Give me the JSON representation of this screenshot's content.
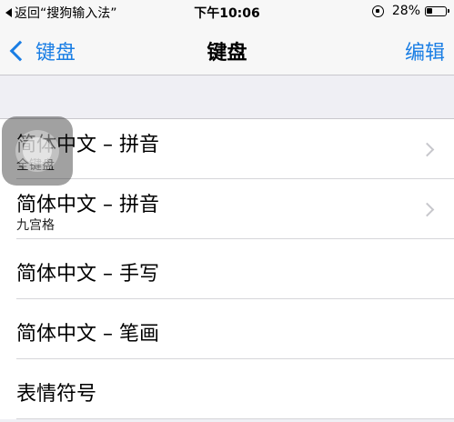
{
  "status_bar": {
    "back_label": "返回“搜狗输入法”",
    "time": "下午10:06",
    "battery": "28%"
  },
  "nav": {
    "back_label": "键盘",
    "title": "键盘",
    "edit_label": "编辑"
  },
  "keyboards": [
    {
      "title": "简体中文 – 拼音",
      "subtitle": "全键盘"
    },
    {
      "title": "简体中文 – 拼音",
      "subtitle": "九宫格"
    },
    {
      "title": "简体中文 – 手写"
    },
    {
      "title": "简体中文 – 笔画"
    },
    {
      "title": "表情符号"
    }
  ]
}
